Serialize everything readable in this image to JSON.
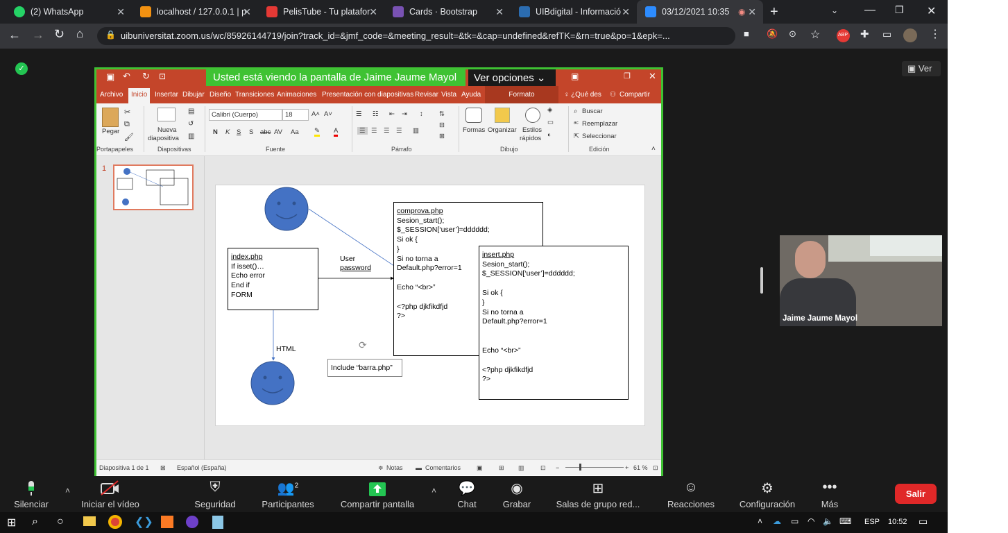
{
  "tabs": [
    {
      "label": "(2) WhatsApp",
      "icon": "whatsapp-icon",
      "color": "#25d366"
    },
    {
      "label": "localhost / 127.0.0.1 | p",
      "icon": "phpmyadmin-icon",
      "color": "#f29111"
    },
    {
      "label": "PelisTube - Tu platafor",
      "icon": "pelistube-icon",
      "color": "#e53935"
    },
    {
      "label": "Cards · Bootstrap",
      "icon": "bootstrap-icon",
      "color": "#7952b3"
    },
    {
      "label": "UIBdigital - Informació",
      "icon": "uib-icon",
      "color": "#2b6cb0"
    },
    {
      "label": "03/12/2021 10:35",
      "icon": "zoom-icon",
      "color": "#2d8cff"
    }
  ],
  "url": "uibuniversitat.zoom.us/wc/85926144719/join?track_id=&jmf_code=&meeting_result=&tk=&cap=undefined&refTK=&rn=true&po=1&epk=...",
  "ver_button": "Ver",
  "banner": "Usted está viendo la pantalla de Jaime Jaume Mayol",
  "ver_opciones": "Ver opciones",
  "ppt": {
    "menu": [
      "Archivo",
      "Inicio",
      "Insertar",
      "Dibujar",
      "Diseño",
      "Transiciones",
      "Animaciones",
      "Presentación con diapositivas",
      "Revisar",
      "Vista",
      "Ayuda",
      "Formato",
      "¿Qué des",
      "Compartir"
    ],
    "groups": {
      "portapapeles": "Portapapeles",
      "diapositivas": "Diapositivas",
      "fuente": "Fuente",
      "parrafo": "Párrafo",
      "dibujo": "Dibujo",
      "edicion": "Edición"
    },
    "pegar": "Pegar",
    "nueva": "Nueva",
    "diapositiva": "diapositiva",
    "font": "Calibri (Cuerpo)",
    "size": "18",
    "formas": "Formas",
    "organizar": "Organizar",
    "estilos": "Estilos",
    "rapidos": "rápidos",
    "buscar": "Buscar",
    "reemplazar": "Reemplazar",
    "seleccionar": "Seleccionar",
    "slide_num": "1",
    "status": {
      "slide": "Diapositiva 1 de 1",
      "lang": "Español (España)",
      "notas": "Notas",
      "comentarios": "Comentarios",
      "zoom": "61 %"
    }
  },
  "diagram": {
    "index": [
      "index.php",
      "If isset()…",
      "Echo error",
      "End if",
      "FORM"
    ],
    "user": "User",
    "password": "password",
    "html": "HTML",
    "include": "Include “barra.php”",
    "comprova": [
      "comprova.php",
      "Sesion_start();",
      "$_SESSION[‘user’]=dddddd;",
      "Si ok {",
      "}",
      "Si no torna a",
      "Default.php?error=1",
      "",
      "Echo “<br>”",
      "",
      "<?php djkfikdfjd",
      "?>"
    ],
    "insert": [
      "insert.php",
      "Sesion_start();",
      "$_SESSION[‘user’]=dddddd;",
      "",
      "Si ok {",
      "}",
      "Si no torna a",
      "Default.php?error=1",
      "",
      "",
      "Echo “<br>”",
      "",
      "<?php djkfikdfjd",
      "?>"
    ]
  },
  "participant": "Jaime Jaume Mayol",
  "toolbar": [
    {
      "label": "Silenciar",
      "icon": "microphone-icon"
    },
    {
      "label": "Iniciar el vídeo",
      "icon": "video-off-icon"
    },
    {
      "label": "Seguridad",
      "icon": "shield-icon"
    },
    {
      "label": "Participantes",
      "icon": "participants-icon",
      "count": "2"
    },
    {
      "label": "Compartir pantalla",
      "icon": "share-screen-icon"
    },
    {
      "label": "Chat",
      "icon": "chat-icon"
    },
    {
      "label": "Grabar",
      "icon": "record-icon"
    },
    {
      "label": "Salas de grupo red...",
      "icon": "breakout-rooms-icon"
    },
    {
      "label": "Reacciones",
      "icon": "reactions-icon"
    },
    {
      "label": "Configuración",
      "icon": "settings-icon"
    },
    {
      "label": "Más",
      "icon": "more-icon"
    }
  ],
  "salir": "Salir",
  "taskbar": {
    "lang": "ESP",
    "time": "10:52"
  }
}
